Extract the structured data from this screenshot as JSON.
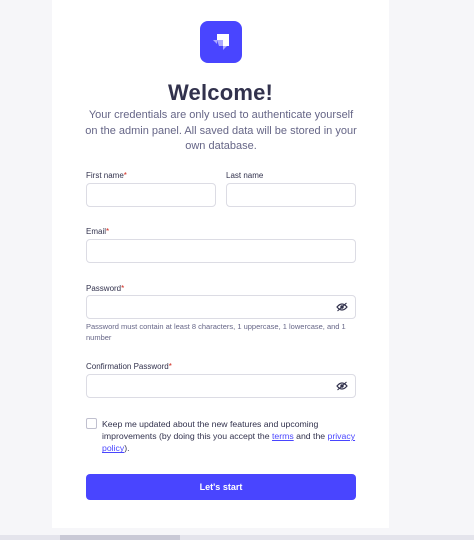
{
  "header": {
    "title": "Welcome!",
    "subtitle": "Your credentials are only used to authenticate yourself on the admin panel. All saved data will be stored in your own database."
  },
  "form": {
    "first_name": {
      "label": "First name",
      "required_mark": "*",
      "value": ""
    },
    "last_name": {
      "label": "Last name",
      "value": ""
    },
    "email": {
      "label": "Email",
      "required_mark": "*",
      "value": ""
    },
    "password": {
      "label": "Password",
      "required_mark": "*",
      "value": "",
      "hint": "Password must contain at least 8 characters, 1 uppercase, 1 lowercase, and 1 number"
    },
    "confirm_password": {
      "label": "Confirmation Password",
      "required_mark": "*",
      "value": ""
    },
    "consent": {
      "checked": false,
      "text_before": "Keep me updated about the new features and upcoming improvements (by doing this you accept the ",
      "terms_link": "terms",
      "text_middle": " and the ",
      "privacy_link": "privacy policy",
      "text_after": ")."
    },
    "submit_label": "Let's start"
  },
  "colors": {
    "primary": "#4945ff",
    "text_dark": "#32324d",
    "text_muted": "#666687",
    "border": "#dcdce4",
    "required": "#d02b20",
    "background": "#f6f6f9"
  },
  "icons": {
    "logo": "strapi-logo-icon",
    "password_toggle": "eye-icon"
  }
}
